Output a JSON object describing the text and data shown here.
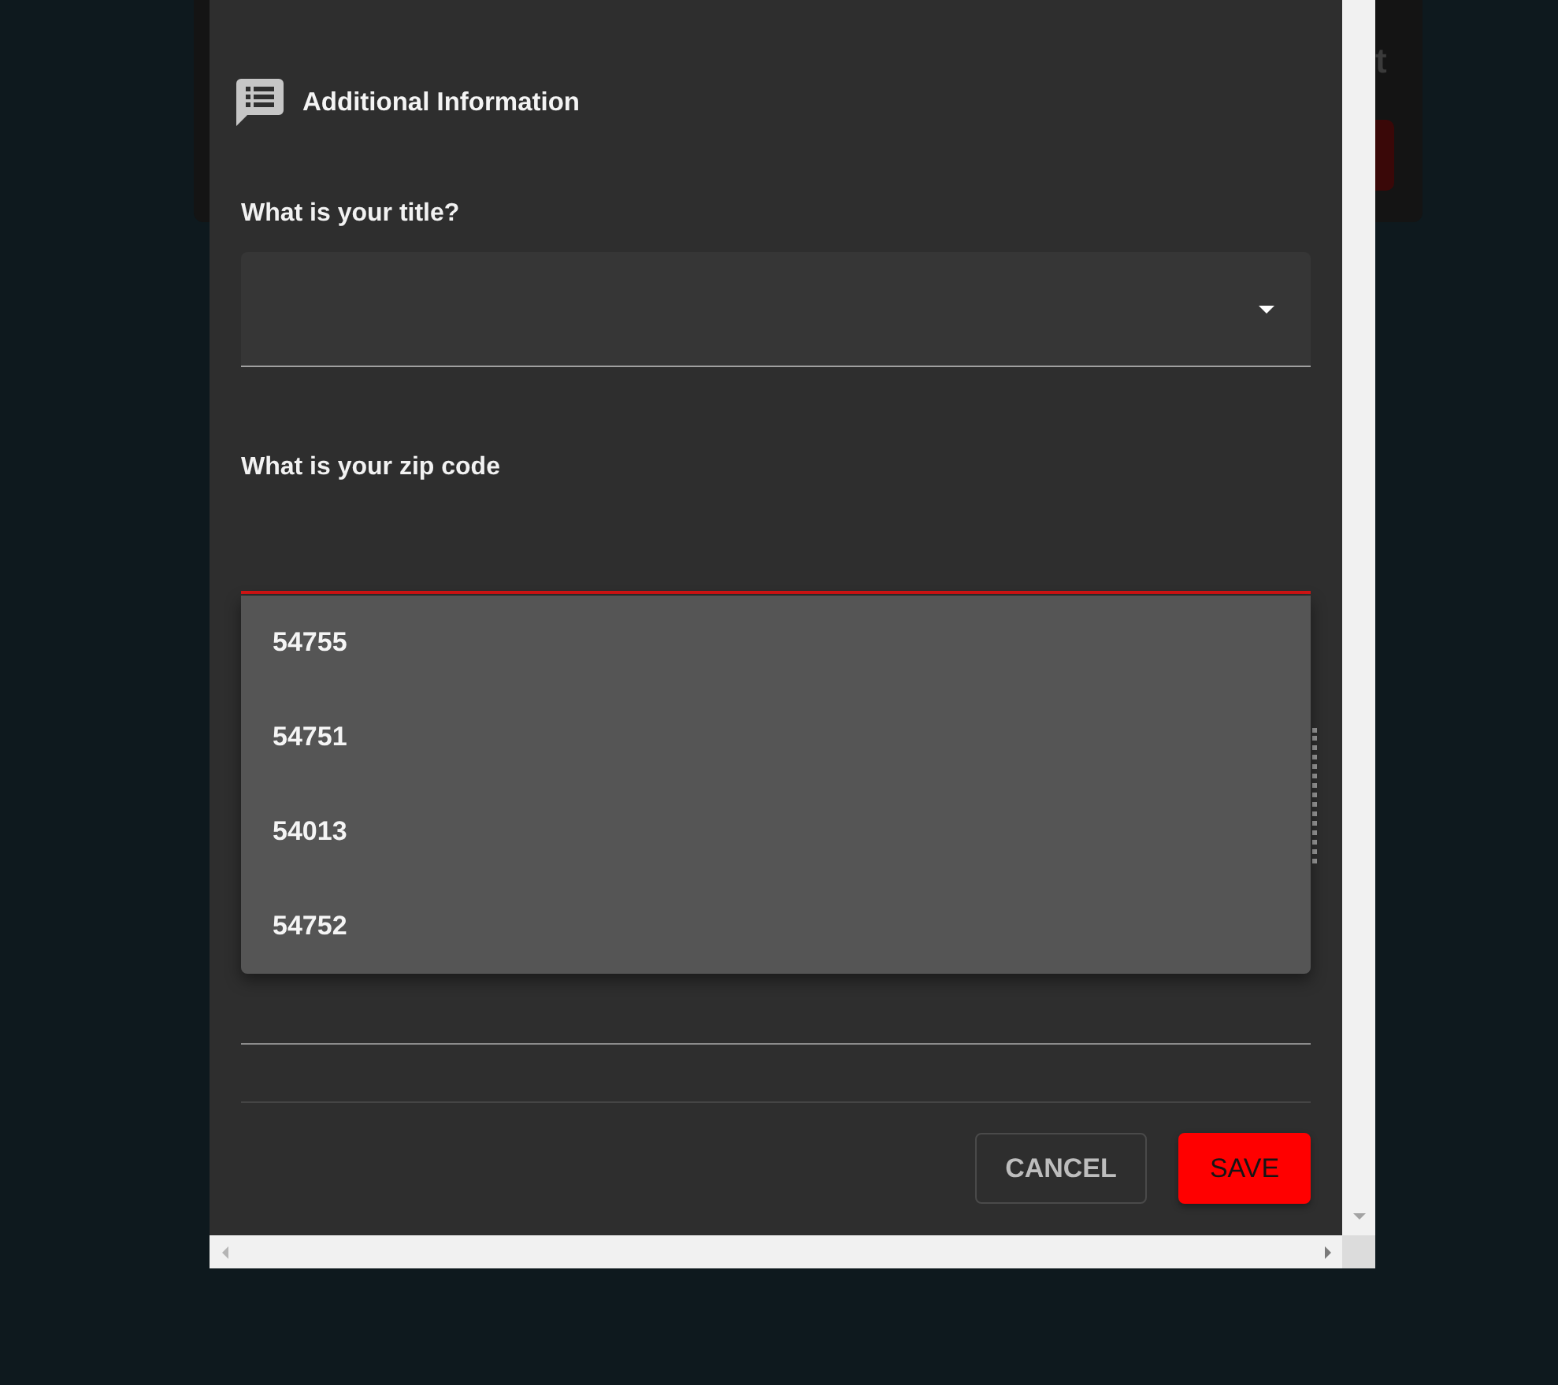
{
  "background_card": {
    "text": "t"
  },
  "section": {
    "title": "Additional Information"
  },
  "fields": [
    {
      "kind": "select",
      "label": "What is your title?",
      "focused": false
    },
    {
      "kind": "text",
      "label": "What is your zip code",
      "focused": true,
      "suggestions": [
        {
          "text": "54755",
          "selected": false
        },
        {
          "text": "54751",
          "selected": false
        },
        {
          "text": "54013",
          "selected": false
        },
        {
          "text": "54752",
          "selected": false
        }
      ]
    },
    {
      "kind": "text",
      "focused": false
    }
  ],
  "buttons": [
    {
      "kind": "outlined",
      "label": "CANCEL"
    },
    {
      "kind": "filled",
      "label": "SAVE"
    }
  ]
}
